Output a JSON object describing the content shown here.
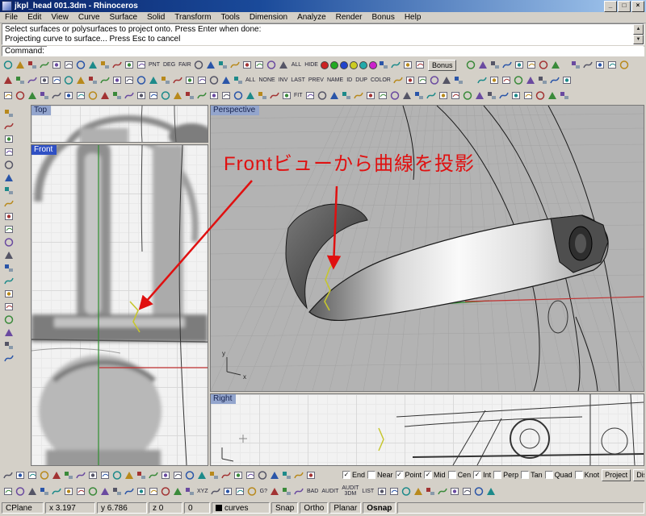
{
  "titlebar": {
    "title": "jkpl_head 001.3dm - Rhinoceros"
  },
  "menubar": {
    "items": [
      "File",
      "Edit",
      "View",
      "Curve",
      "Surface",
      "Solid",
      "Transform",
      "Tools",
      "Dimension",
      "Analyze",
      "Render",
      "Bonus",
      "Help"
    ]
  },
  "command": {
    "history": [
      "Select surfaces or polysurfaces to project onto. Press Enter when done:",
      "Projecting curve to surface... Press Esc to cancel"
    ],
    "prompt": "Command:",
    "value": ""
  },
  "toolbars": {
    "sidebar_icons": 20,
    "rows": {
      "row1": [
        {
          "icons": 12
        },
        {
          "labels": [
            "PNT",
            "DEG",
            "FAIR"
          ]
        },
        {
          "icons": 8
        },
        {
          "labels": [
            "ALL",
            "HIDE"
          ]
        },
        {
          "dots": [
            "#cc2222",
            "#22aa22",
            "#2244cc",
            "#cccc22",
            "#22aaaa",
            "#cc22cc"
          ]
        },
        {
          "icons": 4
        },
        {
          "button": "Bonus"
        },
        {
          "gap": 8
        },
        {
          "icons": 8
        },
        {
          "gap": 10
        },
        {
          "icons": 5
        }
      ],
      "row2": [
        {
          "icons": 20
        },
        {
          "labels": [
            "ALL",
            "NONE",
            "INV",
            "LAST",
            "PREV",
            "NAME",
            "ID",
            "DUP",
            "COLOR"
          ]
        },
        {
          "icons": 6
        },
        {
          "gap": 14
        },
        {
          "icons": 8
        }
      ],
      "row3": [
        {
          "icons": 24
        },
        {
          "labels": [
            "FIT"
          ]
        },
        {
          "icons": 22
        }
      ],
      "bottomA": [
        {
          "icons": 26
        }
      ],
      "bottomB": [
        {
          "icons": 16
        },
        {
          "labels": [
            "XYZ"
          ]
        },
        {
          "icons": 4
        },
        {
          "labels": [
            "G?"
          ]
        },
        {
          "icons": 3
        },
        {
          "labels": [
            "BAD",
            "AUDIT",
            "AUDIT\n3DM",
            "LIST"
          ]
        },
        {
          "icons": 10
        }
      ]
    }
  },
  "viewports": {
    "top": "Top",
    "front": "Front",
    "perspective": "Perspective",
    "right": "Right"
  },
  "annotation": {
    "text": "Frontビューから曲線を投影"
  },
  "osnap": {
    "items": [
      {
        "label": "End",
        "checked": true
      },
      {
        "label": "Near",
        "checked": false
      },
      {
        "label": "Point",
        "checked": true
      },
      {
        "label": "Mid",
        "checked": true
      },
      {
        "label": "Cen",
        "checked": false
      },
      {
        "label": "Int",
        "checked": true
      },
      {
        "label": "Perp",
        "checked": false
      },
      {
        "label": "Tan",
        "checked": false
      },
      {
        "label": "Quad",
        "checked": false
      },
      {
        "label": "Knot",
        "checked": false
      }
    ],
    "project": "Project",
    "disable": "Disable"
  },
  "statusbar": {
    "cplane": "CPlane",
    "x": "x 3.197",
    "y": "y 6.786",
    "z": "z 0",
    "w": "0",
    "layer": "curves",
    "toggles": [
      "Snap",
      "Ortho",
      "Planar",
      "Osnap"
    ],
    "active_toggle": "Osnap"
  },
  "colors": {
    "window_gray": "#d4d0c8",
    "titlebar_left": "#0a246a",
    "titlebar_right": "#a6caf0",
    "annotation_red": "#e01010",
    "projected_curve_yellow": "#c6c62e",
    "axis_red": "#c03030",
    "axis_green": "#2f8f2f",
    "viewport_label_active": "#2f50c4"
  }
}
